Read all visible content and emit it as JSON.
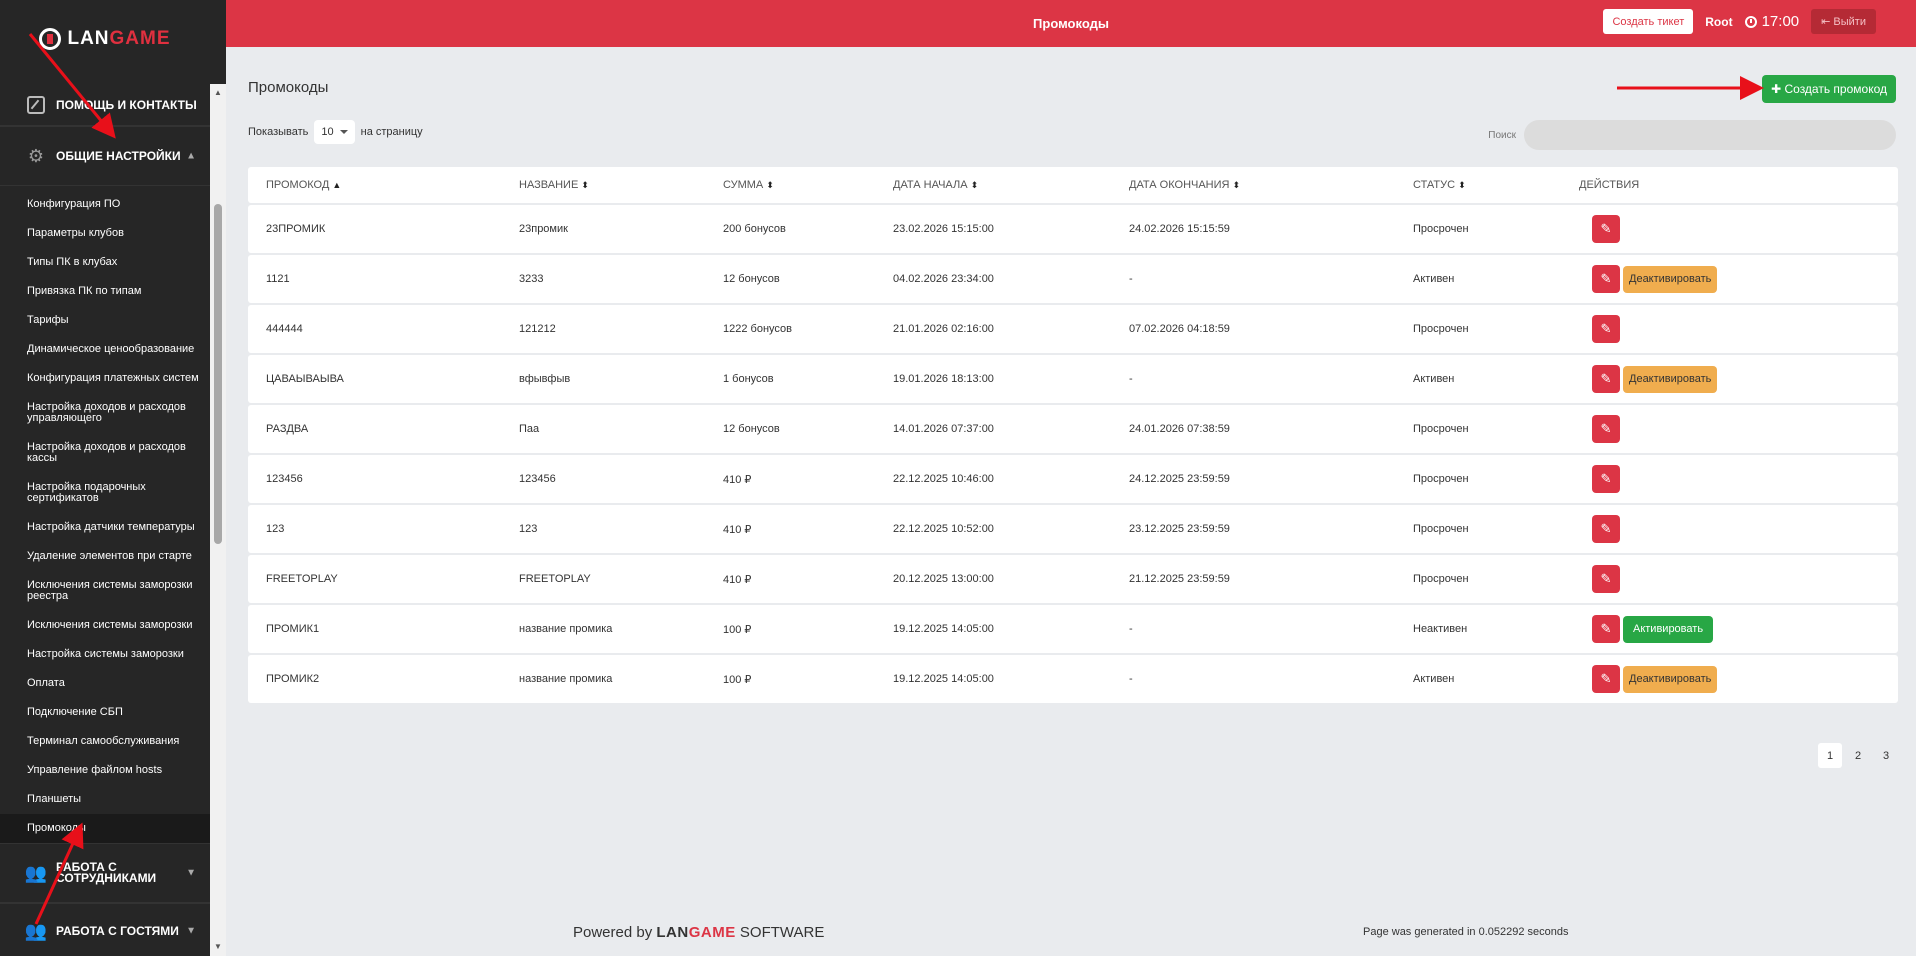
{
  "sidebar": {
    "logo": {
      "lan": "LAN",
      "game": "GAME"
    },
    "sections": [
      {
        "label": "ПОМОЩЬ И КОНТАКТЫ"
      },
      {
        "label": "ОБЩИЕ НАСТРОЙКИ"
      }
    ],
    "items": [
      "Конфигурация ПО",
      "Параметры клубов",
      "Типы ПК в клубах",
      "Привязка ПК по типам",
      "Тарифы",
      "Динамическое ценообразование",
      "Конфигурация платежных систем",
      "Настройка доходов и расходов управляющего",
      "Настройка доходов и расходов кассы",
      "Настройка подарочных сертификатов",
      "Настройка датчики температуры",
      "Удаление элементов при старте",
      "Исключения системы заморозки реестра",
      "Исключения системы заморозки",
      "Настройка системы заморозки",
      "Оплата",
      "Подключение СБП",
      "Терминал самообслуживания",
      "Управление файлом hosts",
      "Планшеты",
      "Промокоды"
    ],
    "bottom_sections": [
      {
        "label": "РАБОТА С СОТРУДНИКАМИ"
      },
      {
        "label": "РАБОТА С ГОСТЯМИ"
      }
    ]
  },
  "topbar": {
    "title": "Промокоды",
    "ticket_label": "Создать тикет",
    "user": "Root",
    "time": "17:00",
    "logout_label": "Выйти"
  },
  "main": {
    "title": "Промокоды",
    "create_label": "Создать промокод",
    "show_label": "Показывать",
    "per_page": "10",
    "per_page_suffix": "на страницу",
    "search_label": "Поиск",
    "columns": [
      "ПРОМОКОД",
      "НАЗВАНИЕ",
      "СУММА",
      "ДАТА НАЧАЛА",
      "ДАТА ОКОНЧАНИЯ",
      "СТАТУС",
      "ДЕЙСТВИЯ"
    ],
    "rows": [
      {
        "code": "23ПРОМИК",
        "name": "23промик",
        "sum": "200 бонусов",
        "start": "23.02.2026 15:15:00",
        "end": "24.02.2026 15:15:59",
        "status": "Просрочен",
        "action": ""
      },
      {
        "code": "1121",
        "name": "3233",
        "sum": "12 бонусов",
        "start": "04.02.2026 23:34:00",
        "end": "-",
        "status": "Активен",
        "action": "Деактивировать"
      },
      {
        "code": "444444",
        "name": "121212",
        "sum": "1222 бонусов",
        "start": "21.01.2026 02:16:00",
        "end": "07.02.2026 04:18:59",
        "status": "Просрочен",
        "action": ""
      },
      {
        "code": "ЦАВАЫВАЫВА",
        "name": "вфывфыв",
        "sum": "1 бонусов",
        "start": "19.01.2026 18:13:00",
        "end": "-",
        "status": "Активен",
        "action": "Деактивировать"
      },
      {
        "code": "РАЗДВА",
        "name": "Паа",
        "sum": "12 бонусов",
        "start": "14.01.2026 07:37:00",
        "end": "24.01.2026 07:38:59",
        "status": "Просрочен",
        "action": ""
      },
      {
        "code": "123456",
        "name": "123456",
        "sum": "410 ₽",
        "start": "22.12.2025 10:46:00",
        "end": "24.12.2025 23:59:59",
        "status": "Просрочен",
        "action": ""
      },
      {
        "code": "123",
        "name": "123",
        "sum": "410 ₽",
        "start": "22.12.2025 10:52:00",
        "end": "23.12.2025 23:59:59",
        "status": "Просрочен",
        "action": ""
      },
      {
        "code": "FREETOPLAY",
        "name": "FREETOPLAY",
        "sum": "410 ₽",
        "start": "20.12.2025 13:00:00",
        "end": "21.12.2025 23:59:59",
        "status": "Просрочен",
        "action": ""
      },
      {
        "code": "ПРОМИК1",
        "name": "название промика",
        "sum": "100 ₽",
        "start": "19.12.2025 14:05:00",
        "end": "-",
        "status": "Неактивен",
        "action": "Активировать"
      },
      {
        "code": "ПРОМИК2",
        "name": "название промика",
        "sum": "100 ₽",
        "start": "19.12.2025 14:05:00",
        "end": "-",
        "status": "Активен",
        "action": "Деактивировать"
      }
    ],
    "pages": [
      "1",
      "2",
      "3"
    ],
    "current_page": "1"
  },
  "footer": {
    "powered_by": "Powered by",
    "brand_lan": "LAN",
    "brand_game": "GAME",
    "software": "SOFTWARE",
    "generated": "Page was generated in 0.052292 seconds"
  },
  "colors": {
    "accent": "#dc3545",
    "success": "#28a745",
    "warning": "#f0ad4e",
    "sidebar": "#262626"
  }
}
